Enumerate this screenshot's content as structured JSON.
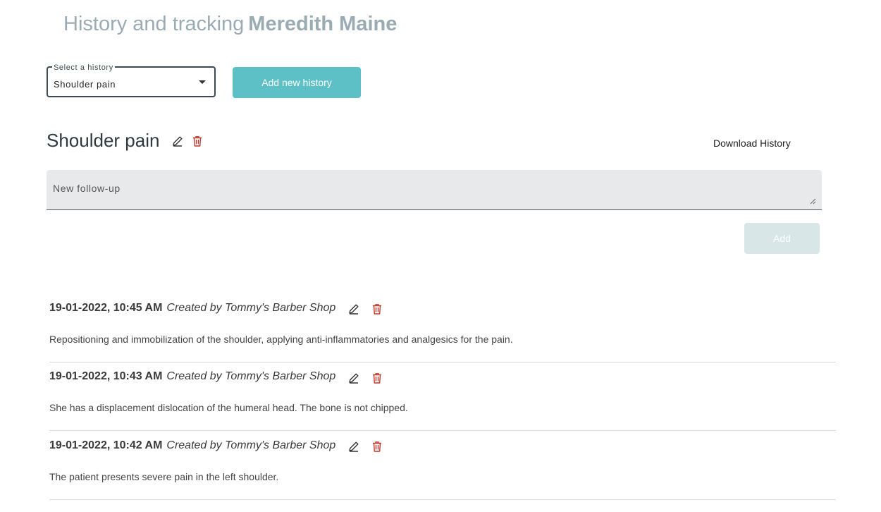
{
  "page": {
    "title_prefix": "History and tracking",
    "patient_name": "Meredith Maine"
  },
  "history_select": {
    "label": "Select a history",
    "selected": "Shoulder pain"
  },
  "add_history_button": "Add new history",
  "current_history": {
    "title": "Shoulder pain",
    "download_label": "Download History"
  },
  "followup": {
    "placeholder": "New follow-up",
    "value": "",
    "add_label": "Add"
  },
  "entries": [
    {
      "date": "19-01-2022, 10:45 AM",
      "author": "Created by Tommy's Barber Shop",
      "text": "Repositioning and immobilization of the shoulder, applying anti-inflammatories and analgesics for the pain."
    },
    {
      "date": "19-01-2022, 10:43 AM",
      "author": "Created by Tommy's Barber Shop",
      "text": "She has a displacement dislocation of the humeral head. The bone is not chipped."
    },
    {
      "date": "19-01-2022, 10:42 AM",
      "author": "Created by Tommy's Barber Shop",
      "text": "The patient presents severe pain in the left shoulder."
    }
  ],
  "colors": {
    "accent": "#5cc0c6",
    "title_gray": "#9aabb3",
    "delete_red": "#c0392b",
    "disabled_button": "#d8e6e8"
  },
  "icons": {
    "edit": "pencil-icon",
    "delete": "trash-icon",
    "dropdown": "chevron-down-icon"
  }
}
